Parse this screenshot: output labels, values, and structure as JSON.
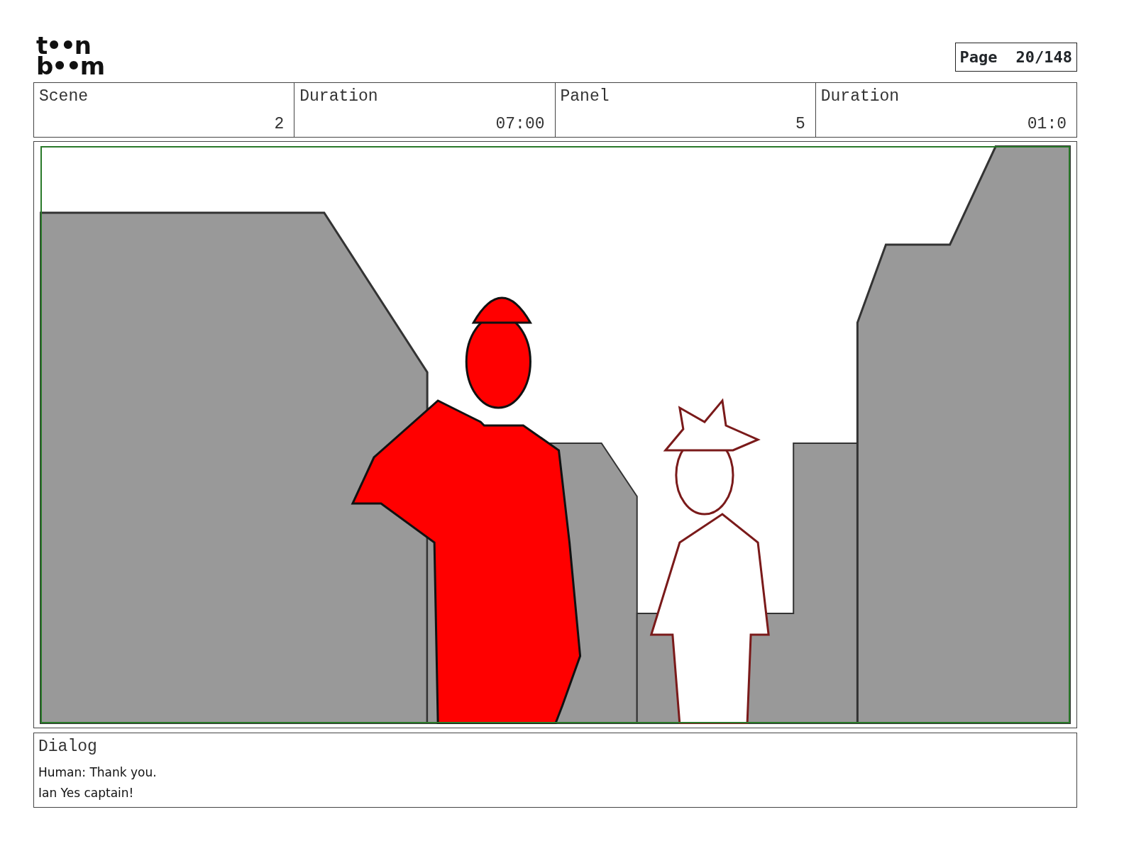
{
  "logo": {
    "line_1": "t••n",
    "line_2": "b••m"
  },
  "page": {
    "label": "Page",
    "value": "20/148"
  },
  "header": [
    {
      "label": "Scene",
      "value": "2"
    },
    {
      "label": "Duration",
      "value": "07:00"
    },
    {
      "label": "Panel",
      "value": "5"
    },
    {
      "label": "Duration",
      "value": "01:0"
    }
  ],
  "dialog": {
    "title": "Dialog",
    "lines": [
      "Human: Thank you.",
      "Ian Yes captain!"
    ]
  }
}
